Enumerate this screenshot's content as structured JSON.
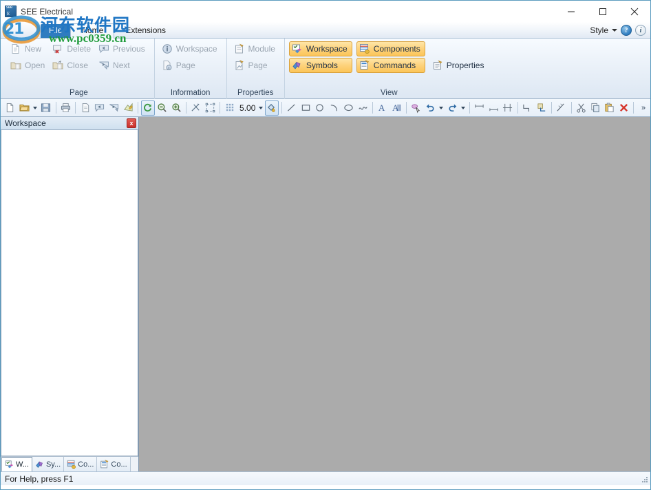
{
  "window": {
    "title": "SEE Electrical",
    "app_icon": "see-electrical-logo",
    "minimize": "—",
    "maximize": "□",
    "close": "✕"
  },
  "tabstrip": {
    "file_tab": "File",
    "tabs": [
      {
        "label": "Home",
        "active": true
      },
      {
        "label": "Extensions",
        "active": false
      }
    ],
    "style_label": "Style",
    "help_icon": "?",
    "info_icon": "i"
  },
  "ribbon": {
    "groups": [
      {
        "title": "Page",
        "columns": [
          {
            "items": [
              {
                "label": "New",
                "icon": "new-page-icon",
                "state": "disabled"
              },
              {
                "label": "Open",
                "icon": "open-folder-icon",
                "state": "disabled"
              }
            ]
          },
          {
            "items": [
              {
                "label": "Delete",
                "icon": "delete-page-icon",
                "state": "disabled"
              },
              {
                "label": "Close",
                "icon": "close-folder-icon",
                "state": "disabled"
              }
            ]
          },
          {
            "items": [
              {
                "label": "Previous",
                "icon": "previous-page-icon",
                "state": "disabled"
              },
              {
                "label": "Next",
                "icon": "next-page-icon",
                "state": "disabled"
              }
            ]
          }
        ]
      },
      {
        "title": "Information",
        "columns": [
          {
            "items": [
              {
                "label": "Workspace",
                "icon": "info-workspace-icon",
                "state": "disabled"
              },
              {
                "label": "Page",
                "icon": "info-page-icon",
                "state": "disabled"
              }
            ]
          }
        ]
      },
      {
        "title": "Properties",
        "columns": [
          {
            "items": [
              {
                "label": "Module",
                "icon": "module-properties-icon",
                "state": "disabled"
              },
              {
                "label": "Page",
                "icon": "page-properties-icon",
                "state": "disabled"
              }
            ]
          }
        ]
      },
      {
        "title": "View",
        "columns": [
          {
            "items": [
              {
                "label": "Workspace",
                "icon": "view-workspace-icon",
                "state": "toggled"
              },
              {
                "label": "Symbols",
                "icon": "view-symbols-icon",
                "state": "toggled"
              }
            ]
          },
          {
            "items": [
              {
                "label": "Components",
                "icon": "view-components-icon",
                "state": "toggled"
              },
              {
                "label": "Commands",
                "icon": "view-commands-icon",
                "state": "toggled"
              }
            ]
          },
          {
            "items": [
              {
                "label": "Properties",
                "icon": "view-properties-icon",
                "state": "normal"
              }
            ]
          }
        ]
      }
    ]
  },
  "toolbar": {
    "grid_value": "5.00",
    "buttons": [
      "new-icon",
      "open-icon",
      "save-icon",
      "print-icon",
      "page-icon",
      "previous-icon",
      "next-icon",
      "print-preview-icon",
      "refresh-icon",
      "zoom-out-icon",
      "zoom-in-icon",
      "zoom-window-icon",
      "zoom-extents-icon",
      "grid-icon",
      "fill-icon",
      "line-icon",
      "rectangle-icon",
      "circle-icon",
      "arc-icon",
      "ellipse-icon",
      "spline-icon",
      "text-icon",
      "text-block-icon",
      "pick-icon",
      "undo-icon",
      "redo-icon",
      "dimension-horizontal-icon",
      "dimension-aligned-icon",
      "dimension-vertical-icon",
      "polyline-icon",
      "corner-icon",
      "trim-icon",
      "cut-icon",
      "copy-icon",
      "paste-icon",
      "delete-icon",
      "overflow-icon"
    ],
    "overflow_label": "»"
  },
  "panel": {
    "title": "Workspace",
    "close_label": "x",
    "tabs": [
      {
        "label": "W...",
        "icon": "workspace-tab-icon",
        "active": true
      },
      {
        "label": "Sy...",
        "icon": "symbols-tab-icon",
        "active": false
      },
      {
        "label": "Co...",
        "icon": "components-tab-icon",
        "active": false
      },
      {
        "label": "Co...",
        "icon": "commands-tab-icon",
        "active": false
      }
    ]
  },
  "statusbar": {
    "message": "For Help, press F1"
  },
  "watermark": {
    "chinese": "河东软件园",
    "url": "www.pc0359.cn"
  },
  "colors": {
    "canvas": "#ababab",
    "accent_orange": "#fcc558",
    "file_tab_blue": "#2f7cc0",
    "close_red": "#c9302c",
    "watermark_blue": "#1f76c4",
    "watermark_green": "#1f9b3a"
  }
}
